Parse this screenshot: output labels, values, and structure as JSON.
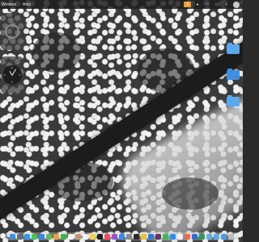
{
  "menubar": {
    "menus": [
      "Window",
      "Help"
    ],
    "tray": {
      "badge_label": "3"
    }
  },
  "widgets": {
    "clock": {
      "numerals": [
        "12",
        "3",
        "6",
        "9"
      ]
    }
  },
  "desktop": {
    "icons": [
      "folder-icon",
      "folder-icon",
      "folder-icon",
      "folder-icon"
    ]
  },
  "dock": {
    "apps": [
      {
        "name": "finder-icon",
        "color": "#3a8ee6"
      },
      {
        "name": "launchpad-icon",
        "color": "#6b6b6b"
      },
      {
        "name": "safari-icon",
        "color": "#2d9cf0"
      },
      {
        "name": "messages-icon",
        "color": "#45c45a"
      },
      {
        "name": "mail-icon",
        "color": "#3a86f0"
      },
      {
        "name": "maps-icon",
        "color": "#5fb85a"
      },
      {
        "name": "photos-icon",
        "color": "#e8a33a"
      },
      {
        "name": "facetime-icon",
        "color": "#39b54a"
      },
      {
        "name": "calendar-icon",
        "color": "#f4f4f4"
      },
      {
        "name": "contacts-icon",
        "color": "#b99a72"
      },
      {
        "name": "reminders-icon",
        "color": "#f2f2f2"
      },
      {
        "name": "notes-icon",
        "color": "#f5d34a"
      },
      {
        "name": "tv-icon",
        "color": "#1e1e1e"
      },
      {
        "name": "music-icon",
        "color": "#f04a5f"
      },
      {
        "name": "podcasts-icon",
        "color": "#9b4fd6"
      },
      {
        "name": "appstore-icon",
        "color": "#2f8cf0"
      },
      {
        "name": "settings-icon",
        "color": "#8a8a8a"
      },
      {
        "name": "terminal-icon",
        "color": "#2a2a2a"
      },
      {
        "name": "chrome-icon",
        "color": "#e8c33a"
      },
      {
        "name": "vscode-icon",
        "color": "#2a7bd6"
      },
      {
        "name": "slack-icon",
        "color": "#6b2f6b"
      },
      {
        "name": "spotify-icon",
        "color": "#2fbf5a"
      },
      {
        "name": "zoom-icon",
        "color": "#2f8cf0"
      },
      {
        "name": "notion-icon",
        "color": "#f2f2f2"
      },
      {
        "name": "figma-icon",
        "color": "#f06a4a"
      },
      {
        "name": "word-icon",
        "color": "#2f6bd6"
      },
      {
        "name": "excel-icon",
        "color": "#2f9a4f"
      },
      {
        "name": "preview-icon",
        "color": "#6fa8e6"
      },
      {
        "name": "folder-icon",
        "color": "#5aa8ee"
      },
      {
        "name": "downloads-icon",
        "color": "#4a9ae6"
      },
      {
        "name": "trash-icon",
        "color": "#bdbdbd"
      }
    ]
  }
}
